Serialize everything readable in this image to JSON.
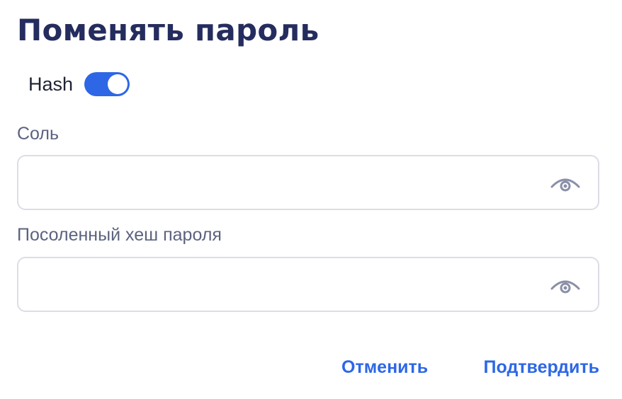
{
  "dialog": {
    "title": "Поменять пароль",
    "hash_toggle": {
      "label": "Hash",
      "on": true
    },
    "fields": {
      "salt": {
        "label": "Соль",
        "value": "",
        "placeholder": ""
      },
      "salted_hash": {
        "label": "Посоленный хеш пароля",
        "value": "",
        "placeholder": ""
      }
    },
    "actions": {
      "cancel_label": "Отменить",
      "confirm_label": "Подтвердить"
    }
  },
  "icons": {
    "reveal": "eye-icon"
  },
  "colors": {
    "accent": "#2d67e6",
    "title": "#252c5e",
    "label": "#5b637f",
    "border": "#dcdde6",
    "icon": "#8a8fa8"
  }
}
